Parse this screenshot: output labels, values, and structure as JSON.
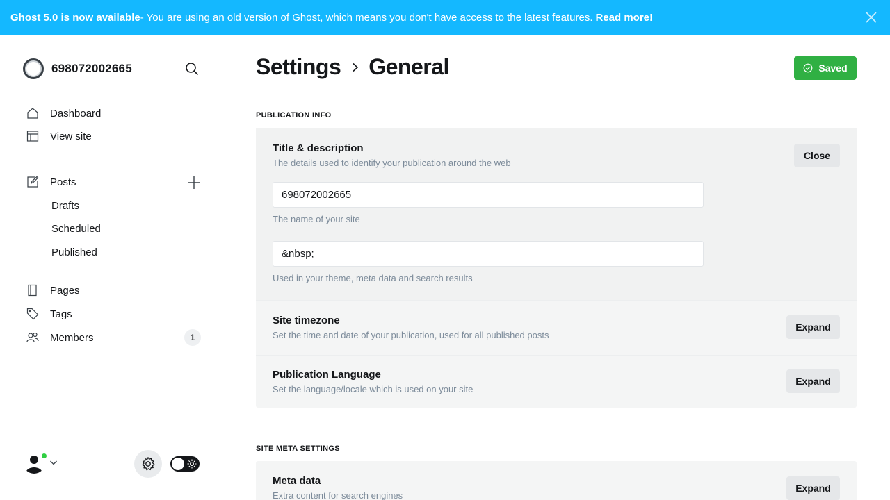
{
  "banner": {
    "headline": "Ghost 5.0 is now available",
    "message": " - You are using an old version of Ghost, which means you don't have access to the latest features.",
    "link": "Read more!"
  },
  "sidebar": {
    "site_name": "698072002665",
    "nav": [
      {
        "label": "Dashboard",
        "icon": "home-icon"
      },
      {
        "label": "View site",
        "icon": "layout-icon"
      },
      {
        "label": "Posts",
        "icon": "edit-icon"
      },
      {
        "label": "Drafts"
      },
      {
        "label": "Scheduled"
      },
      {
        "label": "Published"
      },
      {
        "label": "Pages",
        "icon": "pages-icon"
      },
      {
        "label": "Tags",
        "icon": "tag-icon"
      },
      {
        "label": "Members",
        "icon": "members-icon",
        "badge": "1"
      }
    ],
    "status_color": "#30cf43"
  },
  "header": {
    "crumb_parent": "Settings",
    "crumb_current": "General",
    "saved_label": "Saved",
    "saved_color": "#30b043"
  },
  "sections": {
    "publication_info": "PUBLICATION INFO",
    "site_meta": "SITE META SETTINGS"
  },
  "rows": {
    "title_desc": {
      "title": "Title & description",
      "desc": "The details used to identify your publication around the web",
      "button": "Close",
      "site_title_value": "698072002665",
      "site_title_hint": "The name of your site",
      "description_value": "&nbsp;",
      "description_hint": "Used in your theme, meta data and search results"
    },
    "timezone": {
      "title": "Site timezone",
      "desc": "Set the time and date of your publication, used for all published posts",
      "button": "Expand"
    },
    "language": {
      "title": "Publication Language",
      "desc": "Set the language/locale which is used on your site",
      "button": "Expand"
    },
    "meta": {
      "title": "Meta data",
      "desc": "Extra content for search engines",
      "button": "Expand"
    }
  },
  "accent": "#14b8ff"
}
